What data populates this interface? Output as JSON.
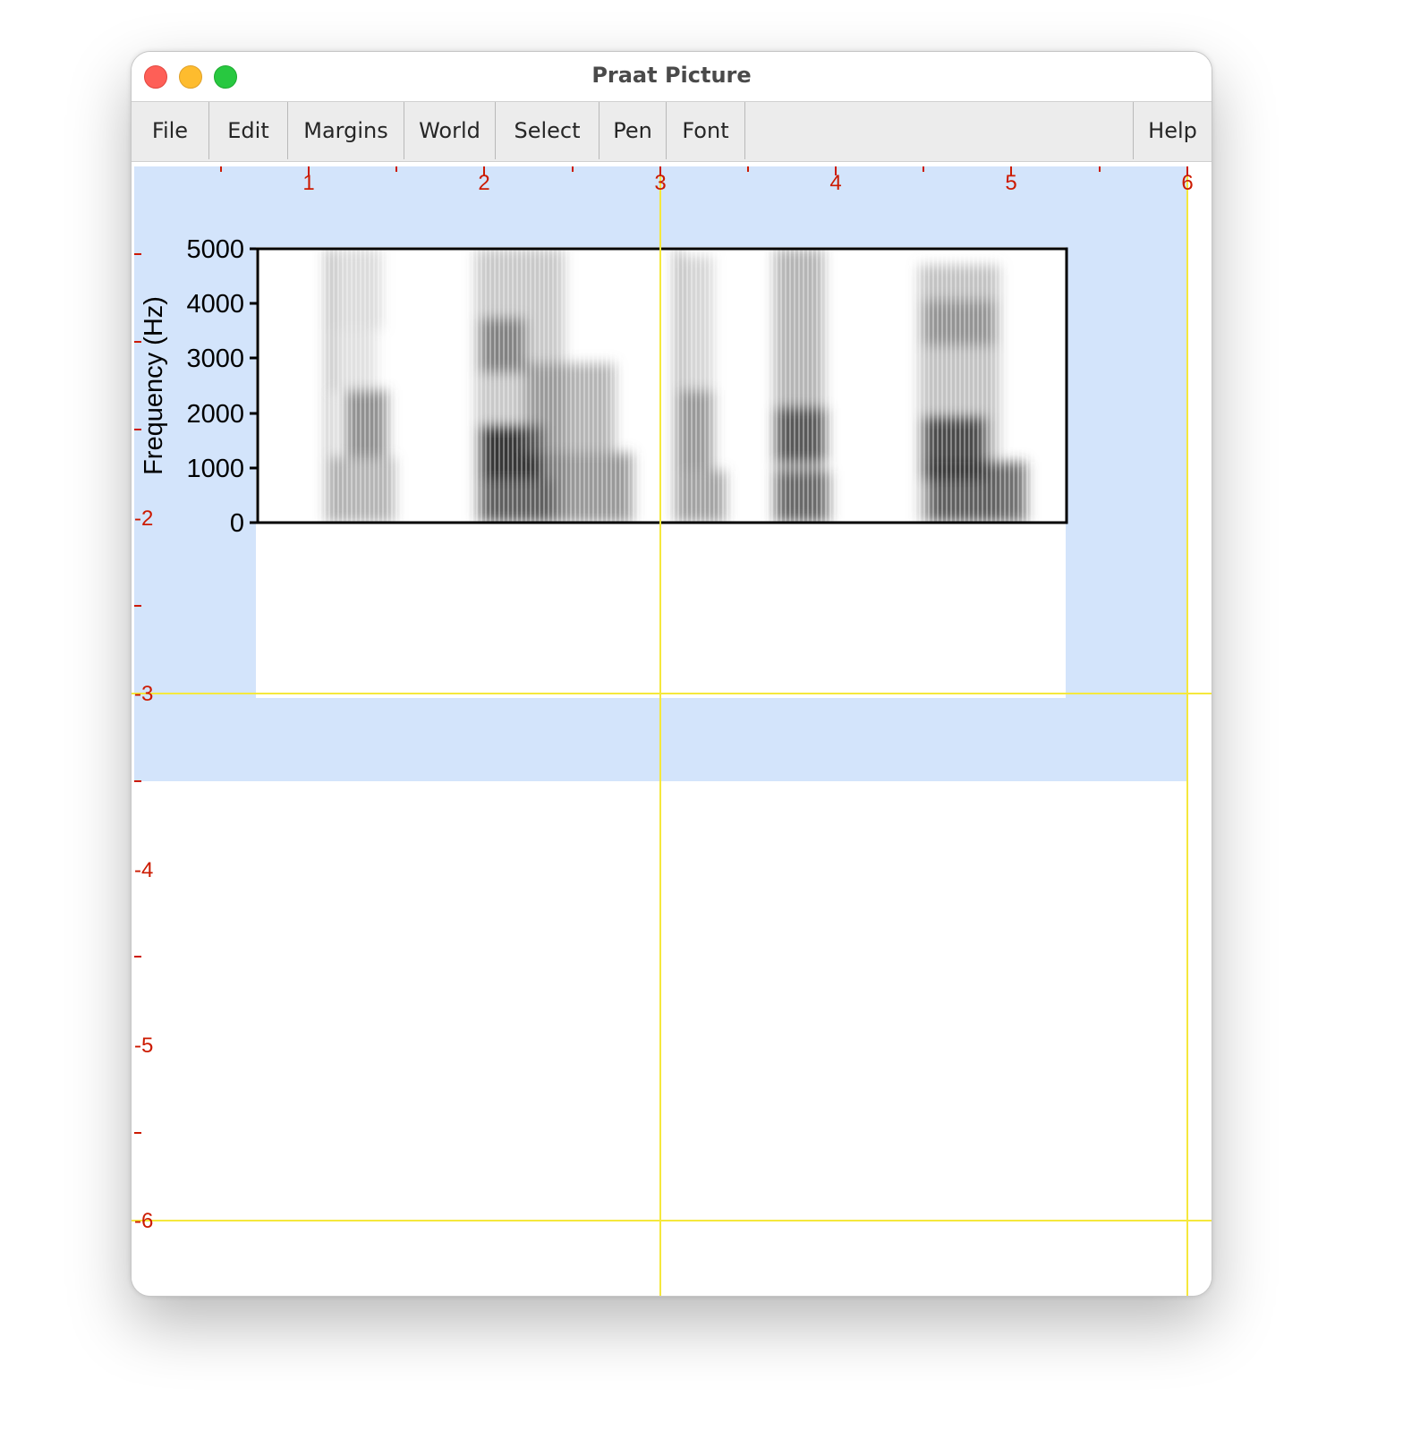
{
  "window": {
    "title": "Praat Picture"
  },
  "menu": {
    "items": [
      "File",
      "Edit",
      "Margins",
      "World",
      "Select",
      "Pen",
      "Font"
    ],
    "help": "Help"
  },
  "ruler": {
    "top_labels": [
      "1",
      "2",
      "3",
      "4",
      "5",
      "6"
    ],
    "left_labels": [
      "-2",
      "-3",
      "-4",
      "-5",
      "-6"
    ]
  },
  "colors": {
    "selection": "#d3e4fb",
    "guide_lines": "#f5e83c",
    "ruler": "#cc1a00"
  },
  "spectrogram": {
    "ylabel": "Frequency (Hz)",
    "y_ticks": [
      "5000",
      "4000",
      "3000",
      "2000",
      "1000",
      "0"
    ],
    "ylim": [
      0,
      5000
    ]
  }
}
